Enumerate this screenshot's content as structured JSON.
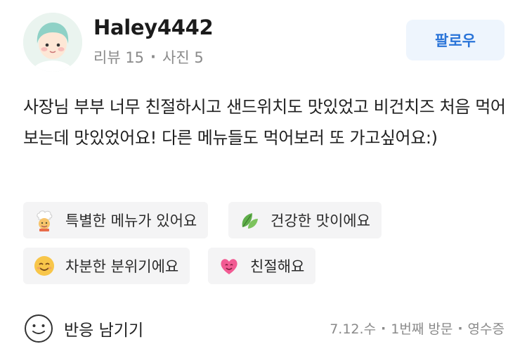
{
  "user": {
    "name": "Haley4442",
    "reviews": "리뷰 15",
    "photos": "사진 5"
  },
  "follow_label": "팔로우",
  "review_text": "사장님 부부 너무 친절하시고 샌드위치도 맛있었고 비건치즈 처음 먹어보는데 맛있었어요! 다른 메뉴들도 먹어보러 또 가고싶어요:)",
  "tags": [
    {
      "label": "특별한 메뉴가 있어요",
      "icon": "chef-icon"
    },
    {
      "label": "건강한 맛이에요",
      "icon": "leaf-icon"
    },
    {
      "label": "차분한 분위기에요",
      "icon": "relieved-face-icon"
    },
    {
      "label": "친절해요",
      "icon": "heart-icon"
    }
  ],
  "reaction_label": "반응 남기기",
  "visit": {
    "date": "7.12.수",
    "count": "1번째 방문",
    "proof": "영수증"
  },
  "colors": {
    "follow_text": "#2a74d8",
    "follow_bg": "#eef5fd",
    "meta": "#8a8a8a",
    "tag_bg": "#f4f4f5"
  }
}
